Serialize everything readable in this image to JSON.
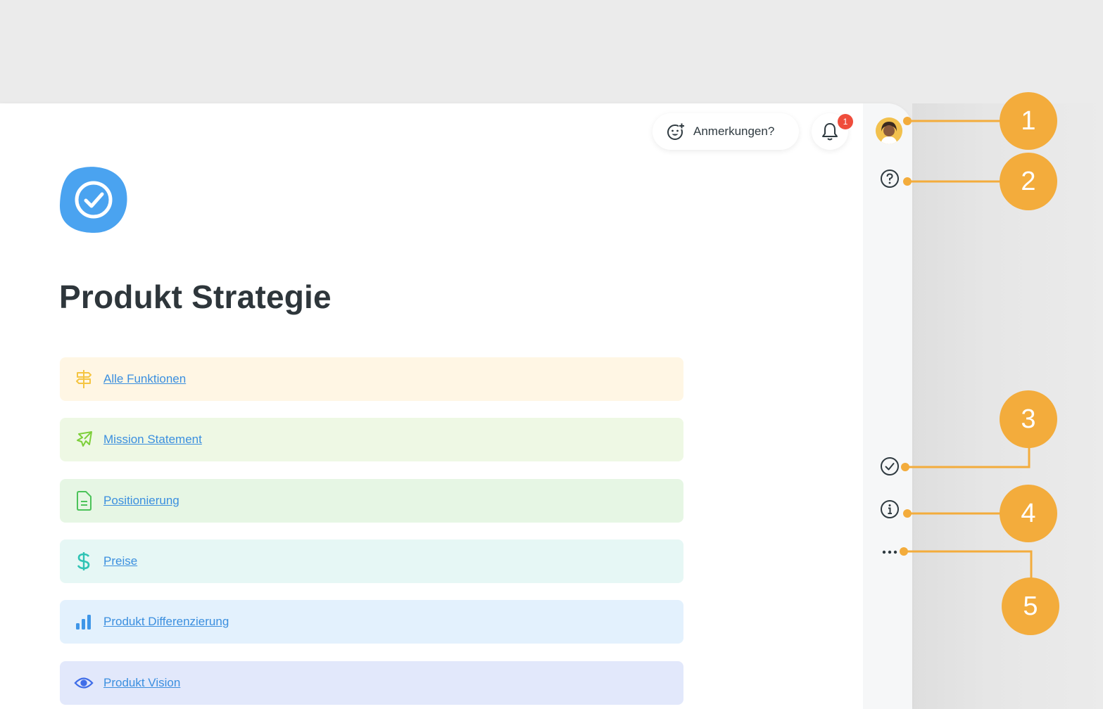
{
  "header": {
    "feedback_label": "Anmerkungen?",
    "notification_count": "1"
  },
  "page": {
    "title": "Produkt Strategie"
  },
  "links": [
    {
      "label": "Alle Funktionen",
      "icon": "signpost-icon",
      "bg": "#fff6e4",
      "icon_color": "#f5c542"
    },
    {
      "label": "Mission Statement",
      "icon": "plane-icon",
      "bg": "#eef8e4",
      "icon_color": "#7dcf3a"
    },
    {
      "label": "Positionierung",
      "icon": "document-icon",
      "bg": "#e6f6e4",
      "icon_color": "#4cc35a"
    },
    {
      "label": "Preise",
      "icon": "dollar-icon",
      "bg": "#e6f7f5",
      "icon_color": "#2fc3b4"
    },
    {
      "label": "Produkt Differenzierung",
      "icon": "bar-chart-icon",
      "bg": "#e3f1fd",
      "icon_color": "#3f96e8"
    },
    {
      "label": "Produkt Vision",
      "icon": "eye-icon",
      "bg": "#e2e8fb",
      "icon_color": "#3f6de8"
    }
  ],
  "rail": {
    "items": [
      "avatar",
      "help-icon",
      "check-circle-icon",
      "info-icon",
      "more-icon"
    ]
  },
  "callouts": [
    "1",
    "2",
    "3",
    "4",
    "5"
  ],
  "colors": {
    "accent_orange": "#f3ac3c",
    "logo_blue": "#4aa3f0",
    "badge_red": "#ef4d3c"
  }
}
